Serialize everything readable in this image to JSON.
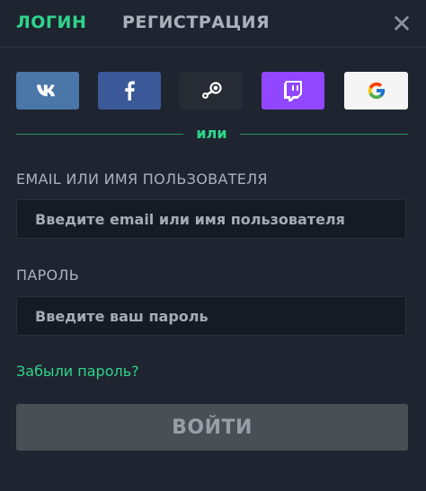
{
  "tabs": {
    "login": "ЛОГИН",
    "register": "РЕГИСТРАЦИЯ"
  },
  "close_icon": "close-icon",
  "social": [
    {
      "name": "vk-icon",
      "color": "#4a76a8"
    },
    {
      "name": "facebook-icon",
      "color": "#3b5998"
    },
    {
      "name": "steam-icon",
      "color": "#262b34"
    },
    {
      "name": "twitch-icon",
      "color": "#9147ff"
    },
    {
      "name": "google-icon",
      "color": "#f5f5f5"
    }
  ],
  "divider": {
    "text": "или"
  },
  "form": {
    "email_label": "EMAIL ИЛИ ИМЯ ПОЛЬЗОВАТЕЛЯ",
    "email_placeholder": "Введите email или имя пользователя",
    "password_label": "ПАРОЛЬ",
    "password_placeholder": "Введите ваш пароль",
    "forgot_link": "Забыли пароль?",
    "submit_label": "ВОЙТИ"
  },
  "colors": {
    "accent": "#2fd58b",
    "background": "#1f2530"
  }
}
